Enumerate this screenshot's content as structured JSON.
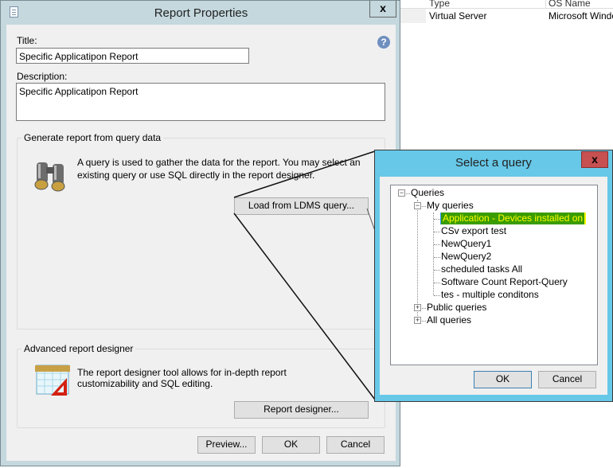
{
  "background_list": {
    "columns": [
      "Type",
      "OS Name"
    ],
    "rows": [
      [
        "Virtual Server",
        "Microsoft Window"
      ]
    ]
  },
  "report_properties": {
    "window_title": "Report Properties",
    "close_label": "x",
    "title_label": "Title:",
    "title_value": "Specific Applicatipon Report",
    "description_label": "Description:",
    "description_value": "Specific Applicatipon Report",
    "query_group": {
      "legend": "Generate report from query data",
      "text": "A query is used to gather the data for the report. You may select an existing query or use SQL directly in the report designer.",
      "button": "Load from LDMS query..."
    },
    "designer_group": {
      "legend": "Advanced report designer",
      "text": "The report designer tool allows for in-depth report customizability and SQL editing.",
      "button": "Report designer..."
    },
    "buttons": {
      "preview": "Preview...",
      "ok": "OK",
      "cancel": "Cancel"
    }
  },
  "select_query": {
    "window_title": "Select a query",
    "close_label": "x",
    "tree": {
      "root": "Queries",
      "my_queries": "My queries",
      "items": [
        "Application - Devices installed on",
        "CSv export test",
        "NewQuery1",
        "NewQuery2",
        "scheduled tasks All",
        "Software Count Report-Query",
        "tes - multiple conditons"
      ],
      "selected": "Application - Devices installed on",
      "public_queries": "Public queries",
      "all_queries": "All queries"
    },
    "buttons": {
      "ok": "OK",
      "cancel": "Cancel"
    },
    "highlight_bg": "#3a9c00",
    "highlight_fg": "#ffff00"
  }
}
